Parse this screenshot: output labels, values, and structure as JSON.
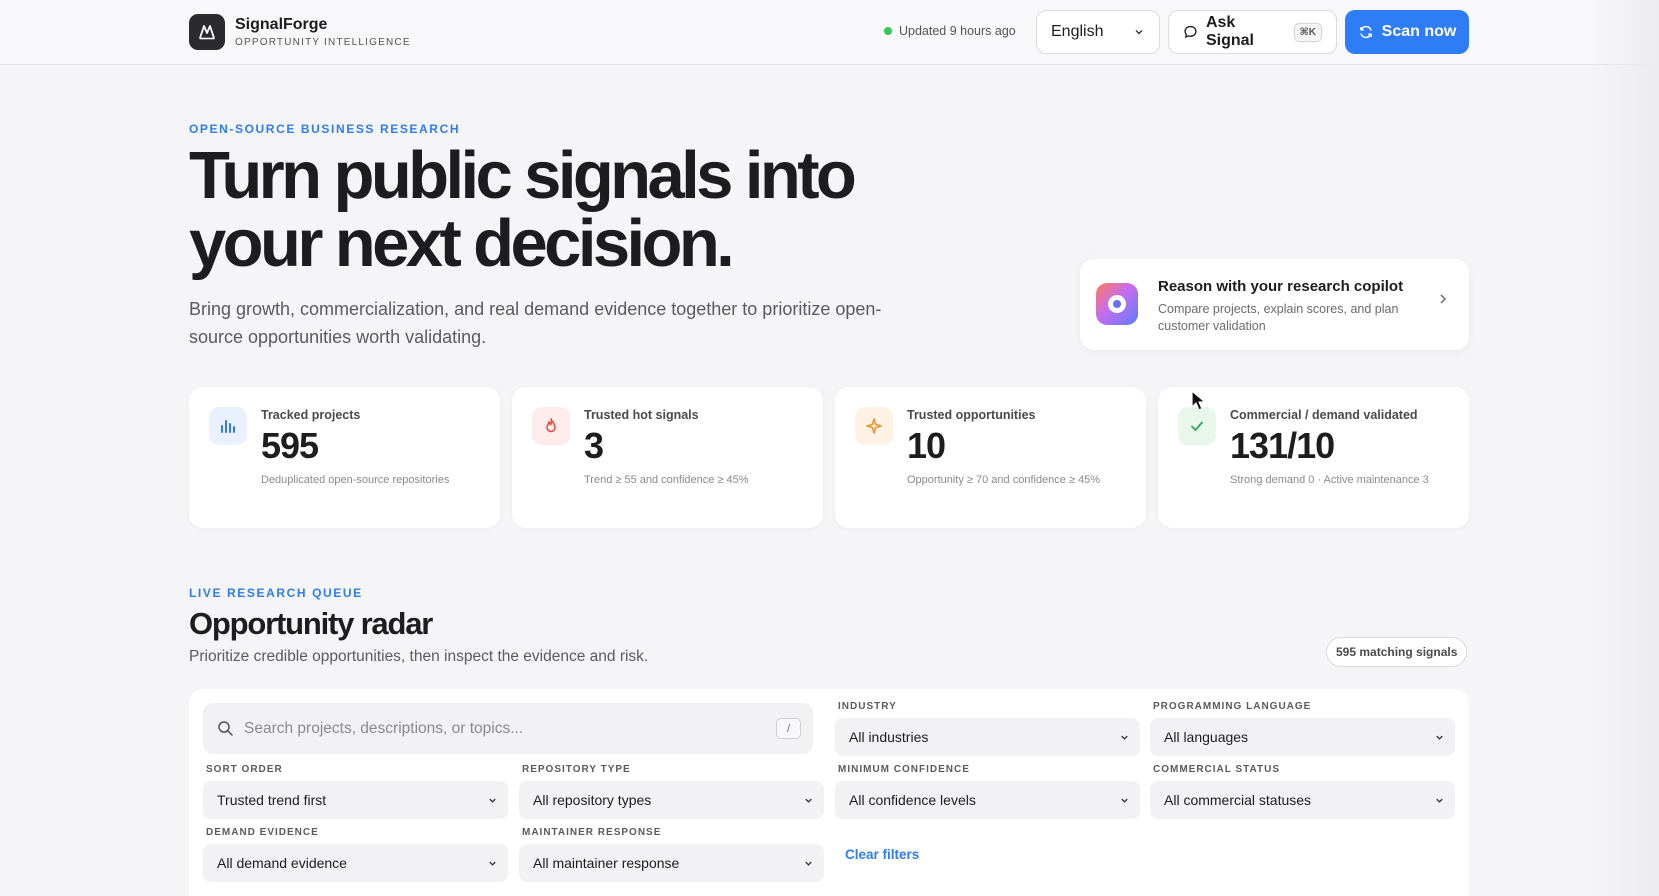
{
  "header": {
    "brand_name": "SignalForge",
    "brand_sub": "OPPORTUNITY INTELLIGENCE",
    "brand_icon": "mountain-logo-icon",
    "updated": "Updated 9 hours ago",
    "status_color": "#34c759",
    "language": "English",
    "ask_label": "Ask Signal",
    "ask_shortcut": "⌘K",
    "scan_label": "Scan now",
    "accent": "#2e7cf6"
  },
  "hero": {
    "eyebrow": "OPEN-SOURCE BUSINESS RESEARCH",
    "title": "Turn public signals into your next decision.",
    "subtitle": "Bring growth, commercialization, and real demand evidence together to prioritize open-source opportunities worth validating."
  },
  "copilot": {
    "title": "Reason with your research copilot",
    "description": "Compare projects, explain scores, and plan customer validation"
  },
  "stats": [
    {
      "label": "Tracked projects",
      "value": "595",
      "note": "Deduplicated open-source repositories",
      "icon": "bar-chart-icon",
      "color": "#3478f6"
    },
    {
      "label": "Trusted hot signals",
      "value": "3",
      "note": "Trend ≥ 55 and confidence ≥ 45%",
      "icon": "flame-icon",
      "color": "#e8483b"
    },
    {
      "label": "Trusted opportunities",
      "value": "10",
      "note": "Opportunity ≥ 70 and confidence ≥ 45%",
      "icon": "sparkle-icon",
      "color": "#f0922a"
    },
    {
      "label": "Commercial / demand validated",
      "value": "131/10",
      "note": "Strong demand 0 · Active maintenance 3",
      "icon": "check-icon",
      "color": "#34a853"
    }
  ],
  "radar": {
    "eyebrow": "LIVE RESEARCH QUEUE",
    "title": "Opportunity radar",
    "subtitle": "Prioritize credible opportunities, then inspect the evidence and risk.",
    "count": "595 matching signals"
  },
  "filters": {
    "search_placeholder": "Search projects, descriptions, or topics...",
    "search_shortcut": "/",
    "industry_label": "INDUSTRY",
    "industry_value": "All industries",
    "language_label": "PROGRAMMING LANGUAGE",
    "language_value": "All languages",
    "sort_label": "SORT ORDER",
    "sort_value": "Trusted trend first",
    "repo_label": "REPOSITORY TYPE",
    "repo_value": "All repository types",
    "confidence_label": "MINIMUM CONFIDENCE",
    "confidence_value": "All confidence levels",
    "commercial_label": "COMMERCIAL STATUS",
    "commercial_value": "All commercial statuses",
    "demand_label": "DEMAND EVIDENCE",
    "demand_value": "All demand evidence",
    "maintainer_label": "MAINTAINER RESPONSE",
    "maintainer_value": "All maintainer response",
    "clear_label": "Clear filters"
  }
}
